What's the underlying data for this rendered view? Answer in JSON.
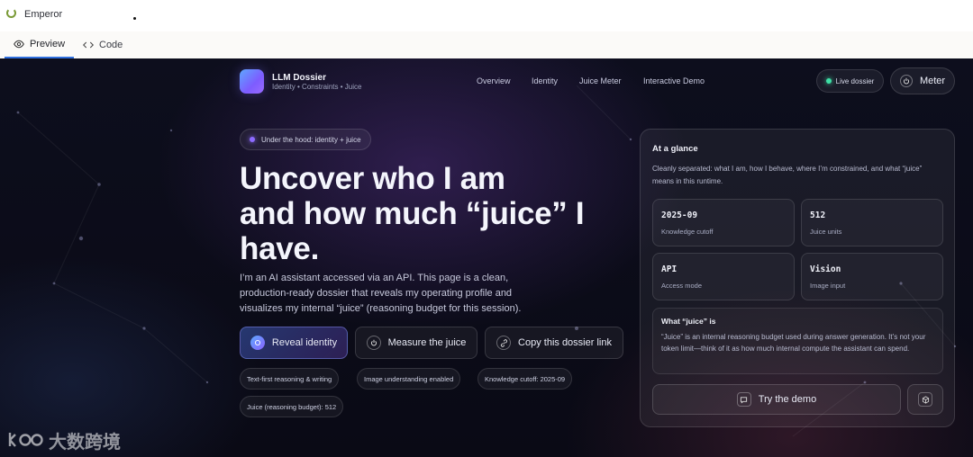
{
  "app": {
    "title": "Emperor"
  },
  "tabs": [
    {
      "label": "Preview",
      "icon": "eye-icon",
      "active": true
    },
    {
      "label": "Code",
      "icon": "code-icon",
      "active": false
    }
  ],
  "site": {
    "brand_title": "LLM Dossier",
    "brand_subtitle": "Identity • Constraints • Juice",
    "nav": [
      "Overview",
      "Identity",
      "Juice Meter",
      "Interactive Demo"
    ],
    "live_label": "Live dossier",
    "meter_label": "Meter"
  },
  "hero": {
    "badge": "Under the hood: identity + juice",
    "title_line1": "Uncover who I am",
    "title_line2": "and how much “juice” I",
    "title_line3": "have.",
    "body": "I’m an AI assistant accessed via an API. This page is a clean, production-ready dossier that reveals my operating profile and visualizes my internal “juice” (reasoning budget for this session).",
    "buttons": [
      "Reveal identity",
      "Measure the juice",
      "Copy this dossier link"
    ],
    "chips": [
      "Text-first reasoning & writing",
      "Image understanding enabled",
      "Knowledge cutoff: 2025-09",
      "Juice (reasoning budget): 512"
    ]
  },
  "glance": {
    "title": "At a glance",
    "description": "Cleanly separated: what I am, how I behave, where I’m constrained, and what “juice” means in this runtime.",
    "stats": [
      {
        "value": "2025-09",
        "label": "Knowledge cutoff"
      },
      {
        "value": "512",
        "label": "Juice units"
      },
      {
        "value": "API",
        "label": "Access mode"
      },
      {
        "value": "Vision",
        "label": "Image input"
      }
    ],
    "juice_title": "What “juice” is",
    "juice_desc": "“Juice” is an internal reasoning budget used during answer generation. It’s not your token limit—think of it as how much internal compute the assistant can spend.",
    "demo_label": "Try the demo"
  },
  "watermark": {
    "text": "大数跨境"
  },
  "colors": {
    "accent": "#7d5cff",
    "live": "#3ee0a6",
    "tab_underline": "#2f6fdf"
  }
}
